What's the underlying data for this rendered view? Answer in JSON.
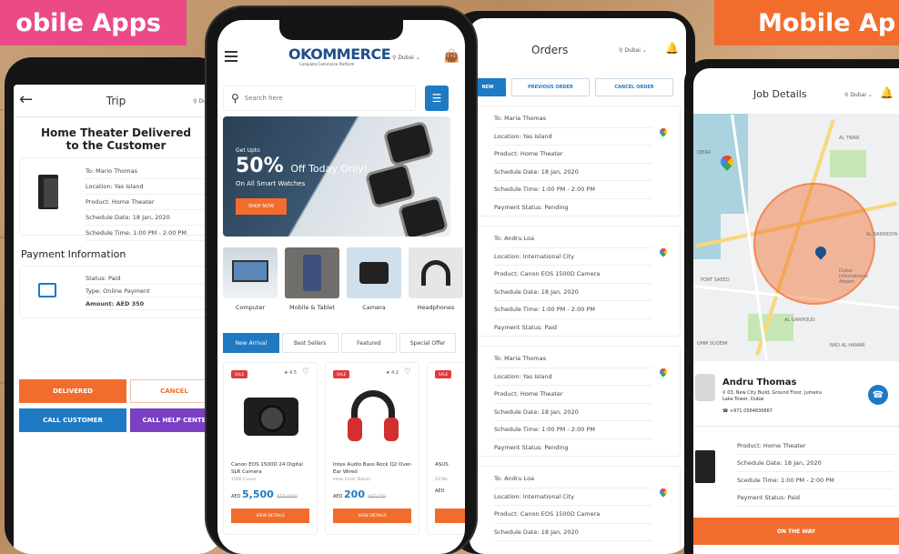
{
  "banners": {
    "left": "obile Apps",
    "right": "Mobile Ap"
  },
  "trip": {
    "title": "Trip",
    "location": "Dubai",
    "heading_line1": "Home Theater Delivered",
    "heading_line2": "to the Customer",
    "details": [
      "To: Mario Thomas",
      "Location: Yas Island",
      "Product: Home Theater",
      "Schedule Date: 18 Jan, 2020",
      "Schedule Time: 1:00 PM - 2:00 PM"
    ],
    "payment_title": "Payment Information",
    "payment": {
      "status": "Status: Paid",
      "type": "Type: Online Payment",
      "amount": "Amount: AED 350"
    },
    "buttons": {
      "delivered": "DELIVERED",
      "cancel": "CANCEL",
      "call_customer": "CALL CUSTOMER",
      "call_help": "CALL HELP CENTE"
    }
  },
  "shop": {
    "logo": "OKOMMERCE",
    "logo_sub": "Complete Commerce Platform",
    "location": "Dubai",
    "search_placeholder": "Search here",
    "hero": {
      "small": "Get Upto",
      "big": "50%",
      "big_rest": "Off Today Only!",
      "line2": "On All Smart Watches",
      "button": "SHOP NOW"
    },
    "categories": [
      "Computer",
      "Mobile & Tablet",
      "Camera",
      "Headphones"
    ],
    "tabs": [
      "New Arrival",
      "Best Sellers",
      "Featured",
      "Special Offer"
    ],
    "products": [
      {
        "badge": "SALE",
        "rating": "4.5",
        "name": "Canon EOS 1500D 24 Digital SLR Camera",
        "sub": "1500 Canon",
        "currency": "AED",
        "price": "5,500",
        "old_price": "AED 6000",
        "button": "VIEW DETAILS"
      },
      {
        "badge": "SALE",
        "rating": "4.2",
        "name": "Intex Audio Bass Rock Q2 Over-Ear Wired",
        "sub": "Intex Corel (Black)",
        "currency": "AED",
        "price": "200",
        "old_price": "AED 250",
        "button": "VIEW DETAILS"
      },
      {
        "badge": "SALE",
        "rating": "",
        "name": "ASUS",
        "sub": "ES Mo",
        "currency": "AED",
        "price": "",
        "old_price": "",
        "button": ""
      }
    ]
  },
  "orders": {
    "title": "Orders",
    "location": "Dubai",
    "tabs": [
      "NEW",
      "PREVIOUS ORDER",
      "CANCEL ORDER"
    ],
    "cards": [
      [
        "To: Maria Thomas",
        "Location: Yas Island",
        "Product: Home Theater",
        "Schedule Date: 18 Jan, 2020",
        "Schedule Time: 1:00 PM - 2:00 PM",
        "Payment Status: Pending"
      ],
      [
        "To: Andru Loa",
        "Location: International City",
        "Product: Canon EOS 1500D Camera",
        "Schedule Date: 18 Jan, 2020",
        "Schedule Time: 1:00 PM - 2:00 PM",
        "Payment Status: Paid"
      ],
      [
        "To: Maria Thomas",
        "Location: Yas Island",
        "Product: Home Theater",
        "Schedule Date: 18 Jan, 2020",
        "Schedule Time: 1:00 PM - 2:00 PM",
        "Payment Status: Pending"
      ],
      [
        "To: Andru Loa",
        "Location: International City",
        "Product: Canon EOS 1500D Camera",
        "Schedule Date: 18 Jan, 2020"
      ]
    ]
  },
  "job": {
    "title": "Job Details",
    "location": "Dubai",
    "map_labels": [
      "DEIRA",
      "AL TWAR",
      "AL RASHIDIYA",
      "Dubai International Airport",
      "AL GARHOUD",
      "NAD AL HAMAR",
      "UMM SUQEIM",
      "PORT SAEED"
    ],
    "name": "Andru Thomas",
    "address": "03, New City Build, Ground Floor, Jumeira Lake Tower, Dubai",
    "phone": "+971 0564830867",
    "product": "Product: Home Theater",
    "date": "Schedule Date: 18 Jan, 2020",
    "time": "Scedule Time: 1:00 PM - 2:00 PM",
    "payment": "Payment Status: Paid",
    "button": "ON THE WAY"
  },
  "colors": {
    "orange": "#f26d2d",
    "blue": "#1f7ac4",
    "pink": "#ec4a86",
    "purple": "#7b3fc4"
  }
}
